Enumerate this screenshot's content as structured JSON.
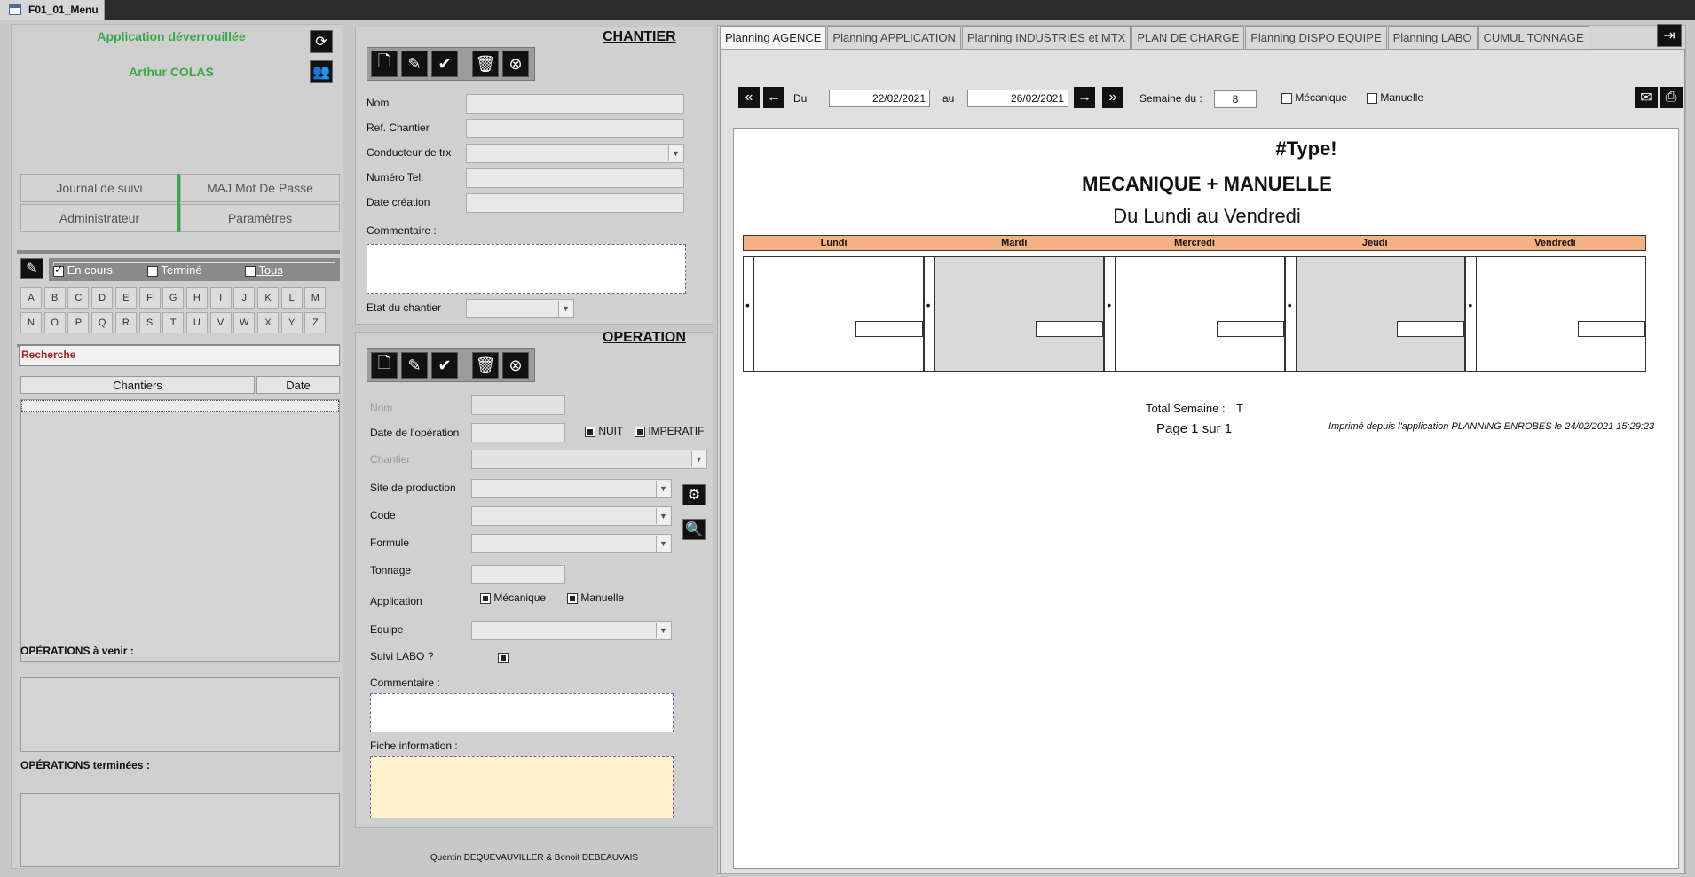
{
  "document_tab": {
    "title": "F01_01_Menu"
  },
  "left": {
    "status": "Application déverrouillée",
    "user": "Arthur COLAS",
    "menu": {
      "journal": "Journal de suivi",
      "maj_mdp": "MAJ Mot De Passe",
      "admin": "Administrateur",
      "params": "Paramètres"
    },
    "filters": {
      "en_cours": "En cours",
      "termine": "Terminé",
      "tous": "Tous"
    },
    "letters": [
      "A",
      "B",
      "C",
      "D",
      "E",
      "F",
      "G",
      "H",
      "I",
      "J",
      "K",
      "L",
      "M",
      "N",
      "O",
      "P",
      "Q",
      "R",
      "S",
      "T",
      "U",
      "V",
      "W",
      "X",
      "Y",
      "Z"
    ],
    "search_label": "Recherche",
    "list_headers": {
      "chantiers": "Chantiers",
      "date": "Date"
    },
    "ops_venir": "OPÉRATIONS à venir :",
    "ops_terminees": "OPÉRATIONS terminées :"
  },
  "chantier": {
    "title": "CHANTIER",
    "labels": {
      "nom": "Nom",
      "ref": "Ref. Chantier",
      "conducteur": "Conducteur de trx",
      "tel": "Numéro Tel.",
      "date_creation": "Date création",
      "commentaire": "Commentaire :",
      "etat": "Etat du chantier"
    }
  },
  "operation": {
    "title": "OPERATION",
    "labels": {
      "nom": "Nom",
      "date_op": "Date de l'opération",
      "nuit": "NUIT",
      "imperatif": "IMPERATIF",
      "chantier": "Chantier",
      "site": "Site de production",
      "code": "Code",
      "formule": "Formule",
      "tonnage": "Tonnage",
      "application": "Application",
      "mecanique": "Mécanique",
      "manuelle": "Manuelle",
      "equipe": "Equipe",
      "suivi_labo": "Suivi LABO ?",
      "commentaire": "Commentaire :",
      "fiche": "Fiche information :"
    }
  },
  "footer_credit": "Quentin DEQUEVAUVILLER  & Benoit DEBEAUVAIS",
  "right": {
    "tabs": [
      "Planning AGENCE",
      "Planning APPLICATION",
      "Planning INDUSTRIES et MTX",
      "PLAN DE CHARGE",
      "Planning DISPO EQUIPE",
      "Planning LABO",
      "CUMUL TONNAGE"
    ],
    "du_label": "Du",
    "date_from": "22/02/2021",
    "au_label": "au",
    "date_to": "26/02/2021",
    "semaine_label": "Semaine du :",
    "semaine_value": "8",
    "mecanique": "Mécanique",
    "manuelle": "Manuelle",
    "report": {
      "type_line": "#Type!",
      "subtitle": "MECANIQUE + MANUELLE",
      "range": "Du Lundi  au Vendredi",
      "days": [
        "Lundi",
        "Mardi",
        "Mercredi",
        "Jeudi",
        "Vendredi"
      ],
      "total_label": "Total Semaine :",
      "total_value": "T",
      "page": "Page 1 sur 1",
      "printed": "Imprimé depuis l'application PLANNING ENROBES le 24/02/2021 15:29:23"
    }
  },
  "colors": {
    "accent_green": "#3aa84a",
    "days_header": "#f4b183",
    "fiche_bg": "#fff2cc",
    "recherche_red": "#b01e1e"
  }
}
